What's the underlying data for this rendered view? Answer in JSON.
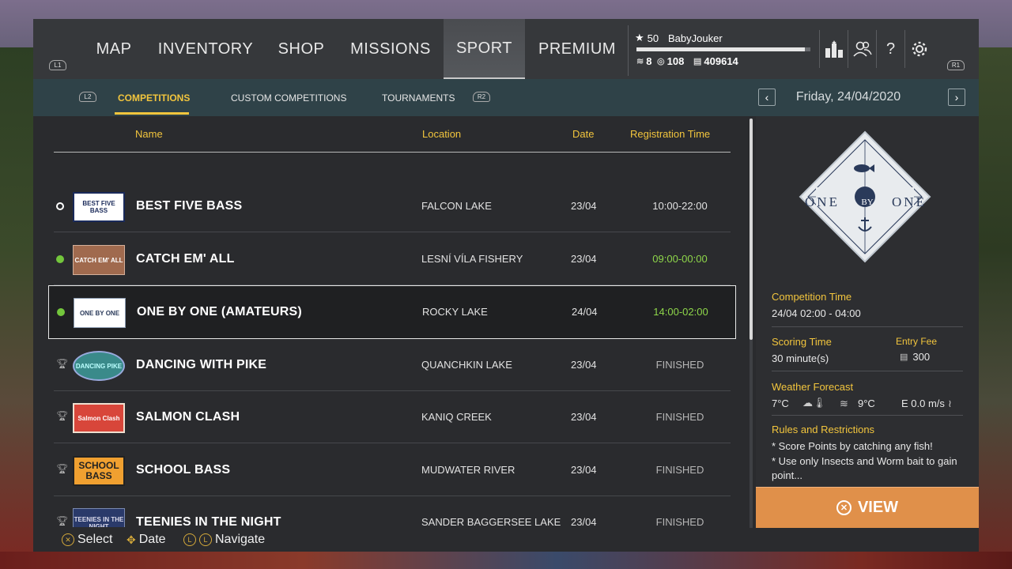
{
  "nav": {
    "hint_left": "L1",
    "hint_right": "R1",
    "tabs": [
      {
        "label": "MAP"
      },
      {
        "label": "INVENTORY"
      },
      {
        "label": "SHOP"
      },
      {
        "label": "MISSIONS"
      },
      {
        "label": "SPORT",
        "active": true
      },
      {
        "label": "PREMIUM"
      }
    ]
  },
  "profile": {
    "level": "50",
    "name": "BabyJouker",
    "xp_progress": 0.97,
    "currency_a": "8",
    "currency_b": "108",
    "currency_c": "409614"
  },
  "icons": [
    "leaderboard-icon",
    "friends-icon",
    "help-icon",
    "settings-icon"
  ],
  "subnav": {
    "hint_left": "L2",
    "hint_right": "R2",
    "tabs": [
      {
        "label": "COMPETITIONS",
        "active": true
      },
      {
        "label": "CUSTOM COMPETITIONS"
      },
      {
        "label": "TOURNAMENTS"
      }
    ],
    "date": "Friday, 24/04/2020"
  },
  "columns": {
    "name": "Name",
    "location": "Location",
    "date": "Date",
    "registration": "Registration Time"
  },
  "competitions": [
    {
      "status": "open",
      "logo": "BEST FIVE BASS",
      "name": "BEST FIVE BASS",
      "location": "FALCON LAKE",
      "date": "23/04",
      "time": "10:00-22:00"
    },
    {
      "status": "live",
      "logo": "CATCH EM' ALL",
      "name": "CATCH EM' ALL",
      "location": "LESNÍ VÍLA FISHERY",
      "date": "23/04",
      "time": "09:00-00:00"
    },
    {
      "status": "live",
      "logo": "ONE BY ONE",
      "name": "ONE BY ONE (AMATEURS)",
      "location": "ROCKY LAKE",
      "date": "24/04",
      "time": "14:00-02:00",
      "selected": true
    },
    {
      "status": "finished",
      "logo": "DANCING PIKE",
      "name": "DANCING WITH PIKE",
      "location": "QUANCHKIN LAKE",
      "date": "23/04",
      "time": "FINISHED"
    },
    {
      "status": "finished",
      "logo": "Salmon Clash",
      "name": "SALMON CLASH",
      "location": "KANIQ CREEK",
      "date": "23/04",
      "time": "FINISHED"
    },
    {
      "status": "finished",
      "logo": "SCHOOL BASS",
      "name": "SCHOOL BASS",
      "location": "MUDWATER RIVER",
      "date": "23/04",
      "time": "FINISHED"
    },
    {
      "status": "finished",
      "logo": "TEENIES IN THE NIGHT",
      "name": "TEENIES IN THE NIGHT",
      "location": "SANDER BAGGERSEE LAKE",
      "date": "23/04",
      "time": "FINISHED"
    }
  ],
  "details": {
    "emblem_left": "ONE",
    "emblem_mid": "BY",
    "emblem_right": "ONE",
    "competition_time_label": "Competition Time",
    "competition_time": "24/04 02:00 - 04:00",
    "scoring_time_label": "Scoring Time",
    "scoring_time": "30 minute(s)",
    "entry_fee_label": "Entry Fee",
    "entry_fee": "300",
    "weather_label": "Weather Forecast",
    "air_temp": "7°C",
    "water_temp": "9°C",
    "wind": "E 0.0 m/s",
    "rules_label": "Rules and Restrictions",
    "rule_1": "* Score Points by catching any fish!",
    "rule_2": "* Use only Insects and Worm bait to gain point..."
  },
  "view_button": "VIEW",
  "footer": {
    "select": "Select",
    "date": "Date",
    "navigate": "Navigate"
  },
  "colors": {
    "accent": "#f2c53d",
    "live": "#73c63c",
    "view_button": "#e0904a"
  }
}
